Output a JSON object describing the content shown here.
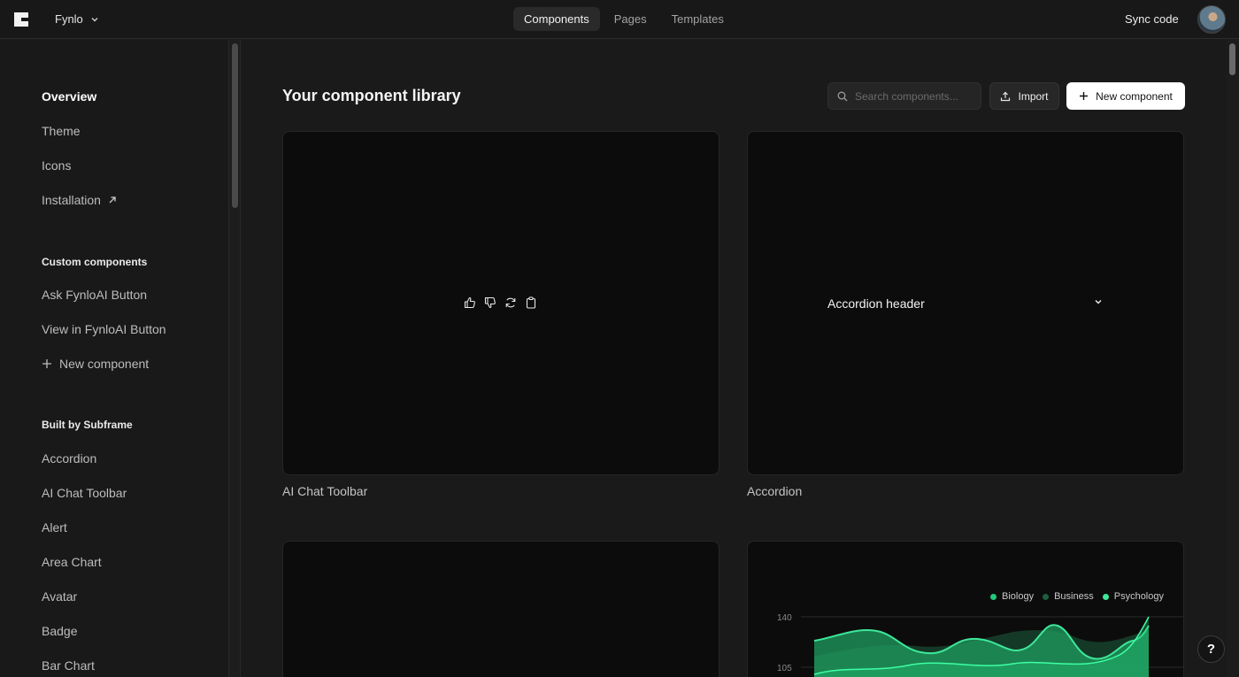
{
  "topbar": {
    "workspace_name": "Fynlo",
    "tabs": [
      {
        "label": "Components",
        "active": true
      },
      {
        "label": "Pages",
        "active": false
      },
      {
        "label": "Templates",
        "active": false
      }
    ],
    "sync_label": "Sync code"
  },
  "sidebar": {
    "primary": [
      {
        "label": "Overview",
        "active": true
      },
      {
        "label": "Theme"
      },
      {
        "label": "Icons"
      },
      {
        "label": "Installation",
        "icon": "external-link-icon"
      }
    ],
    "custom_heading": "Custom components",
    "custom": [
      {
        "label": "Ask FynloAI Button"
      },
      {
        "label": "View in FynloAI Button"
      },
      {
        "label": "New component",
        "icon": "plus-icon"
      }
    ],
    "builtin_heading": "Built by Subframe",
    "builtin": [
      {
        "label": "Accordion"
      },
      {
        "label": "AI Chat Toolbar"
      },
      {
        "label": "Alert"
      },
      {
        "label": "Area Chart"
      },
      {
        "label": "Avatar"
      },
      {
        "label": "Badge"
      },
      {
        "label": "Bar Chart"
      }
    ]
  },
  "main": {
    "title": "Your component library",
    "search_placeholder": "Search components...",
    "import_label": "Import",
    "new_component_label": "New component",
    "cards": [
      {
        "label": "AI Chat Toolbar",
        "preview": "ai-chat-toolbar",
        "icons": [
          "thumbs-up-icon",
          "thumbs-down-icon",
          "refresh-icon",
          "clipboard-icon"
        ]
      },
      {
        "label": "Accordion",
        "preview": "accordion",
        "accordion_header": "Accordion header"
      },
      {
        "label": "",
        "preview": "empty"
      },
      {
        "label": "",
        "preview": "area-chart"
      }
    ]
  },
  "colors": {
    "accent_green": "#22c97a",
    "dark_green": "#1d6b45",
    "light_green": "#3dffa4"
  },
  "chart_data": {
    "type": "area",
    "series": [
      {
        "name": "Biology",
        "color": "#22c97a"
      },
      {
        "name": "Business",
        "color": "#1d5e3e"
      },
      {
        "name": "Psychology",
        "color": "#3de89a"
      }
    ],
    "y_ticks": [
      140,
      105
    ],
    "legend_position": "top-right"
  },
  "help_label": "?"
}
